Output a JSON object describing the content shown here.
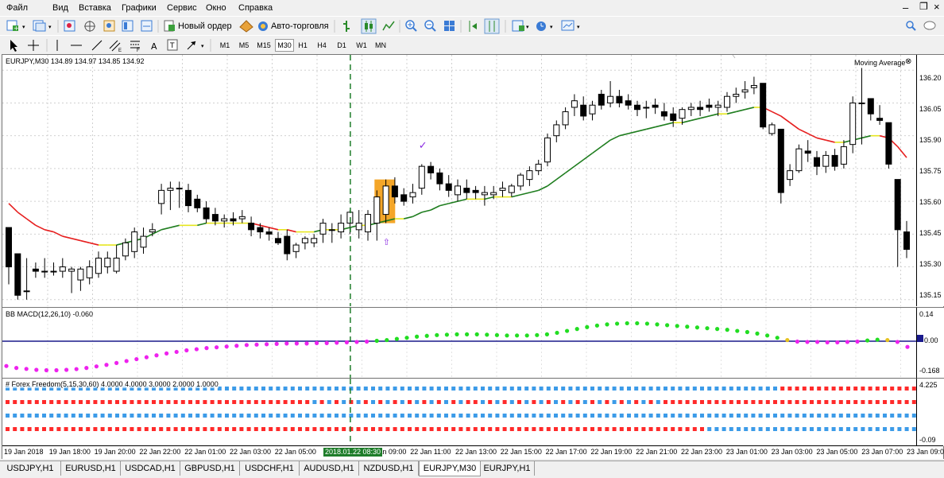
{
  "menu": [
    "Файл",
    "Вид",
    "Вставка",
    "Графики",
    "Сервис",
    "Окно",
    "Справка"
  ],
  "toolbar": {
    "new_order": "Новый ордер",
    "auto_trading": "Авто-торговля",
    "timeframes": [
      "M1",
      "M5",
      "M15",
      "M30",
      "H1",
      "H4",
      "D1",
      "W1",
      "MN"
    ],
    "selected_tf": "M30"
  },
  "chart": {
    "header": "EURJPY,M30  134.89 134.97 134.85 134.92",
    "indicator_label": "Moving Average",
    "macd_label": "BB MACD(12,26,10) -0.060",
    "ff_label": "# Forex Freedom(5,15,30,60) 4.0000 4.0000 3.0000 2.0000 1.0000",
    "price_ticks": [
      "136.20",
      "136.05",
      "135.90",
      "135.75",
      "135.60",
      "135.45",
      "135.30",
      "135.15"
    ],
    "macd_ticks": [
      "0.14",
      "0.00",
      "-0.168"
    ],
    "ff_ticks": [
      "4.225",
      "-0.09"
    ],
    "time_ticks": [
      "19 Jan 2018",
      "19 Jan 18:00",
      "19 Jan 20:00",
      "22 Jan 22:00",
      "22 Jan 01:00",
      "22 Jan 03:00",
      "22 Jan 05:00",
      "22 Jan 07:00",
      "22 Jan 09:00",
      "22 Jan 11:00",
      "22 Jan 13:00",
      "22 Jan 15:00",
      "22 Jan 17:00",
      "22 Jan 19:00",
      "22 Jan 21:00",
      "22 Jan 23:00",
      "23 Jan 01:00",
      "23 Jan 03:00",
      "23 Jan 05:00",
      "23 Jan 07:00",
      "23 Jan 09:00"
    ],
    "crosshair_time": "2018.01.22 08:30"
  },
  "chart_data": {
    "type": "candlestick",
    "symbol": "EURJPY",
    "timeframe": "M30",
    "ylim": [
      135.12,
      136.27
    ],
    "candles": [
      [
        135.48,
        135.48,
        135.3,
        135.22
      ],
      [
        135.36,
        135.36,
        135.17,
        135.15
      ],
      [
        135.19,
        135.34,
        135.19,
        135.15
      ],
      [
        135.29,
        135.32,
        135.28,
        135.25
      ],
      [
        135.28,
        135.34,
        135.28,
        135.25
      ],
      [
        135.28,
        135.32,
        135.28,
        135.26
      ],
      [
        135.28,
        135.34,
        135.3,
        135.25
      ],
      [
        135.28,
        135.3,
        135.29,
        135.18
      ],
      [
        135.24,
        135.3,
        135.29,
        135.19
      ],
      [
        135.25,
        135.33,
        135.3,
        135.22
      ],
      [
        135.27,
        135.37,
        135.34,
        135.25
      ],
      [
        135.3,
        135.37,
        135.34,
        135.27
      ],
      [
        135.28,
        135.4,
        135.34,
        135.27
      ],
      [
        135.35,
        135.43,
        135.41,
        135.33
      ],
      [
        135.37,
        135.48,
        135.46,
        135.34
      ],
      [
        135.39,
        135.48,
        135.44,
        135.36
      ],
      [
        135.46,
        135.5,
        135.47,
        135.44
      ],
      [
        135.59,
        135.68,
        135.65,
        135.54
      ],
      [
        135.65,
        135.69,
        135.66,
        135.56
      ],
      [
        135.66,
        135.69,
        135.66,
        135.57
      ],
      [
        135.65,
        135.68,
        135.58,
        135.55
      ],
      [
        135.61,
        135.63,
        135.57,
        135.55
      ],
      [
        135.57,
        135.6,
        135.52,
        135.5
      ],
      [
        135.54,
        135.57,
        135.51,
        135.49
      ],
      [
        135.51,
        135.54,
        135.52,
        135.48
      ],
      [
        135.52,
        135.55,
        135.51,
        135.49
      ],
      [
        135.52,
        135.56,
        135.53,
        135.5
      ],
      [
        135.5,
        135.53,
        135.47,
        135.44
      ],
      [
        135.48,
        135.5,
        135.46,
        135.43
      ],
      [
        135.46,
        135.48,
        135.45,
        135.42
      ],
      [
        135.43,
        135.46,
        135.41,
        135.4
      ],
      [
        135.44,
        135.47,
        135.36,
        135.33
      ],
      [
        135.37,
        135.41,
        135.4,
        135.34
      ],
      [
        135.41,
        135.44,
        135.43,
        135.38
      ],
      [
        135.41,
        135.45,
        135.43,
        135.39
      ],
      [
        135.45,
        135.52,
        135.5,
        135.41
      ],
      [
        135.47,
        135.5,
        135.47,
        135.41
      ],
      [
        135.46,
        135.54,
        135.5,
        135.43
      ],
      [
        135.5,
        135.56,
        135.55,
        135.45
      ],
      [
        135.47,
        135.56,
        135.5,
        135.43
      ],
      [
        135.46,
        135.56,
        135.54,
        135.42
      ],
      [
        135.5,
        135.65,
        135.62,
        135.42
      ],
      [
        135.54,
        135.7,
        135.67,
        135.5
      ],
      [
        135.67,
        135.71,
        135.62,
        135.59
      ],
      [
        135.63,
        135.66,
        135.6,
        135.58
      ],
      [
        135.62,
        135.68,
        135.64,
        135.59
      ],
      [
        135.66,
        135.77,
        135.76,
        135.63
      ],
      [
        135.76,
        135.78,
        135.73,
        135.7
      ],
      [
        135.73,
        135.75,
        135.68,
        135.65
      ],
      [
        135.68,
        135.72,
        135.65,
        135.62
      ],
      [
        135.63,
        135.7,
        135.67,
        135.6
      ],
      [
        135.66,
        135.7,
        135.64,
        135.61
      ],
      [
        135.65,
        135.67,
        135.64,
        135.61
      ],
      [
        135.63,
        135.67,
        135.64,
        135.58
      ],
      [
        135.63,
        135.67,
        135.64,
        135.61
      ],
      [
        135.65,
        135.69,
        135.66,
        135.62
      ],
      [
        135.64,
        135.68,
        135.67,
        135.62
      ],
      [
        135.67,
        135.73,
        135.72,
        135.65
      ],
      [
        135.7,
        135.76,
        135.74,
        135.67
      ],
      [
        135.74,
        135.79,
        135.77,
        135.72
      ],
      [
        135.78,
        135.91,
        135.89,
        135.76
      ],
      [
        135.9,
        135.97,
        135.95,
        135.87
      ],
      [
        135.95,
        136.03,
        136.01,
        135.93
      ],
      [
        136.03,
        136.09,
        136.06,
        135.99
      ],
      [
        136.04,
        136.08,
        135.99,
        135.97
      ],
      [
        136.0,
        136.06,
        136.04,
        135.97
      ],
      [
        136.09,
        136.11,
        136.04,
        136.02
      ],
      [
        136.05,
        136.15,
        136.08,
        136.03
      ],
      [
        136.08,
        136.11,
        136.05,
        136.03
      ],
      [
        136.06,
        136.09,
        136.04,
        136.02
      ],
      [
        136.04,
        136.06,
        136.02,
        135.99
      ],
      [
        136.03,
        136.06,
        136.03,
        135.98
      ],
      [
        136.04,
        136.07,
        136.03,
        136.0
      ],
      [
        136.01,
        136.05,
        135.99,
        135.97
      ],
      [
        136.0,
        136.03,
        135.97,
        135.94
      ],
      [
        135.98,
        136.03,
        136.02,
        135.95
      ],
      [
        136.02,
        136.05,
        136.03,
        135.99
      ],
      [
        136.03,
        136.06,
        136.02,
        135.99
      ],
      [
        136.04,
        136.07,
        136.03,
        136.01
      ],
      [
        136.03,
        136.06,
        136.04,
        135.99
      ],
      [
        136.03,
        136.1,
        136.08,
        136.01
      ],
      [
        136.08,
        136.12,
        136.09,
        136.05
      ],
      [
        136.1,
        136.15,
        136.11,
        136.07
      ],
      [
        136.12,
        136.17,
        136.13,
        136.09
      ],
      [
        136.14,
        136.14,
        135.94,
        135.93
      ],
      [
        135.91,
        135.96,
        135.95,
        135.9
      ],
      [
        135.93,
        135.93,
        135.64,
        135.59
      ],
      [
        135.7,
        135.77,
        135.74,
        135.67
      ],
      [
        135.74,
        135.86,
        135.84,
        135.73
      ],
      [
        135.83,
        135.88,
        135.82,
        135.78
      ],
      [
        135.8,
        135.83,
        135.76,
        135.72
      ],
      [
        135.76,
        135.83,
        135.81,
        135.73
      ],
      [
        135.81,
        135.84,
        135.76,
        135.74
      ],
      [
        135.77,
        135.88,
        135.85,
        135.75
      ],
      [
        135.86,
        136.08,
        136.05,
        135.82
      ],
      [
        136.05,
        136.21,
        136.05,
        135.86
      ],
      [
        136.07,
        136.07,
        136.0,
        135.97
      ],
      [
        135.98,
        136.04,
        135.97,
        135.95
      ],
      [
        135.96,
        135.96,
        135.77,
        135.75
      ],
      [
        135.7,
        135.7,
        135.47,
        135.3
      ],
      [
        135.46,
        135.51,
        135.38,
        135.34
      ]
    ],
    "moving_average": [
      135.59,
      135.55,
      135.52,
      135.49,
      135.47,
      135.46,
      135.44,
      135.43,
      135.42,
      135.41,
      135.4,
      135.4,
      135.4,
      135.41,
      135.42,
      135.43,
      135.45,
      135.47,
      135.48,
      135.49,
      135.49,
      135.49,
      135.5,
      135.5,
      135.5,
      135.5,
      135.5,
      135.5,
      135.49,
      135.48,
      135.47,
      135.47,
      135.46,
      135.46,
      135.46,
      135.47,
      135.47,
      135.47,
      135.48,
      135.49,
      135.49,
      135.5,
      135.51,
      135.52,
      135.52,
      135.53,
      135.55,
      135.56,
      135.58,
      135.59,
      135.6,
      135.61,
      135.61,
      135.61,
      135.62,
      135.62,
      135.62,
      135.63,
      135.64,
      135.65,
      135.67,
      135.7,
      135.73,
      135.76,
      135.79,
      135.82,
      135.85,
      135.88,
      135.9,
      135.91,
      135.92,
      135.93,
      135.94,
      135.95,
      135.96,
      135.96,
      135.97,
      135.98,
      135.99,
      136.0,
      136.0,
      136.01,
      136.02,
      136.03,
      136.03,
      136.01,
      135.99,
      135.96,
      135.93,
      135.91,
      135.89,
      135.88,
      135.87,
      135.87,
      135.88,
      135.89,
      135.9,
      135.9,
      135.89,
      135.85,
      135.8
    ],
    "macd": [
      -0.13,
      -0.14,
      -0.145,
      -0.15,
      -0.152,
      -0.152,
      -0.15,
      -0.146,
      -0.14,
      -0.132,
      -0.124,
      -0.114,
      -0.104,
      -0.094,
      -0.084,
      -0.074,
      -0.064,
      -0.056,
      -0.048,
      -0.042,
      -0.036,
      -0.032,
      -0.028,
      -0.024,
      -0.02,
      -0.018,
      -0.016,
      -0.014,
      -0.012,
      -0.012,
      -0.012,
      -0.01,
      -0.01,
      -0.008,
      -0.006,
      -0.004,
      -0.002,
      0.002,
      0.006,
      0.012,
      0.018,
      0.024,
      0.028,
      0.032,
      0.034,
      0.036,
      0.036,
      0.036,
      0.034,
      0.032,
      0.03,
      0.03,
      0.03,
      0.032,
      0.036,
      0.044,
      0.054,
      0.064,
      0.074,
      0.082,
      0.088,
      0.092,
      0.094,
      0.094,
      0.092,
      0.088,
      0.084,
      0.08,
      0.076,
      0.072,
      0.068,
      0.064,
      0.06,
      0.054,
      0.048,
      0.04,
      0.03,
      0.018,
      0.006,
      -0.002,
      -0.004,
      -0.004,
      -0.006,
      -0.006,
      -0.004,
      -0.002,
      0.004,
      0.008,
      0.006,
      -0.004,
      -0.03
    ]
  }
}
